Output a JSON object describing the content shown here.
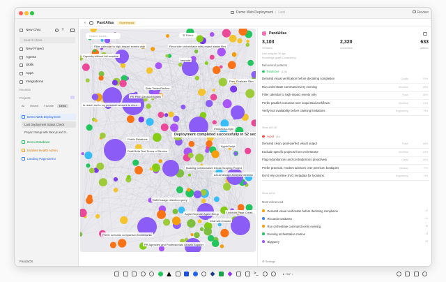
{
  "window": {
    "breadcrumb": [
      "Demo Web Deployment",
      "Last"
    ],
    "review": "Review",
    "lights": [
      "#ff5f57",
      "#febc2e",
      "#28c840"
    ]
  },
  "sidebar": {
    "new_chat": "New Chat",
    "search_placeholder": "Search chats...",
    "nav": [
      {
        "label": "New Project",
        "icon": "folder-plus-icon"
      },
      {
        "label": "Agents",
        "icon": "agent-icon"
      },
      {
        "label": "Skills",
        "icon": "skills-icon"
      },
      {
        "label": "Apps",
        "icon": "apps-icon"
      },
      {
        "label": "Integrations",
        "icon": "integrations-icon"
      }
    ],
    "recents_label": "Recents",
    "projects_label": "Projects",
    "filters": [
      "All",
      "Recent",
      "Favorite",
      "Demo"
    ],
    "projects": [
      {
        "label": "Demo Web Deployment",
        "color": "#3b82f6",
        "active": true
      },
      {
        "label": "Demo Database",
        "color": "#22c55e",
        "active": false
      },
      {
        "label": "Incident Health Admin",
        "color": "#f59e0b",
        "active": false
      },
      {
        "label": "Landing Page Demo",
        "color": "#3b82f6",
        "active": false
      }
    ],
    "subitems": [
      "Last Deployment Status Check",
      "Project Setup with Next.js and S..."
    ],
    "workspace": "PandaOS"
  },
  "tab": {
    "title": "PandAtlas",
    "badge": "Experimental"
  },
  "graph": {
    "search_placeholder": "Search nodes...",
    "filters_label": "Filters",
    "labels": [
      {
        "text": "Filter calendar to high-impact events only"
      },
      {
        "text": "Reconcile orchestrator with project status files"
      },
      {
        "text": "Capacity without full rewrites"
      },
      {
        "text": "keynote"
      },
      {
        "text": "Prev. Evaluate Slim..."
      },
      {
        "text": "Beta Tester Review"
      },
      {
        "text": "PR Pitch Decision Matrix"
      },
      {
        "text": "to reach out to my personal network to chec..."
      },
      {
        "text": "PandaOs-Legal"
      },
      {
        "text": "Deployment completed successfully in 52 seconds with",
        "big": true
      },
      {
        "text": "Public Relations"
      },
      {
        "text": "AppleScript"
      },
      {
        "text": "Draft Beta Test Terms of Service"
      },
      {
        "text": "Building Collaborative Decks Scoping Project"
      },
      {
        "text": "AI Landscape Analysis German"
      },
      {
        "text": "DMW usage retention query"
      },
      {
        "text": "LinkedIn Page Creati..."
      },
      {
        "text": "Apple Keynote Agent Setup"
      },
      {
        "text": "Chat with Claude"
      },
      {
        "text": "Prefer scenario comparison frameworks"
      },
      {
        "text": "PR Agencies and Professionals Growth Support"
      }
    ]
  },
  "panel": {
    "title": "PandAtlas",
    "stats": [
      {
        "value": "3,103",
        "label": "memories"
      },
      {
        "value": "2,320",
        "label": "connections"
      },
      {
        "value": "633",
        "label": "patterns"
      }
    ],
    "analyzed": "Last analyzed 3h ago",
    "analyzed_sub": "Knowledge graph Consistency",
    "behavioral_label": "Behavioral patterns",
    "reinforce": {
      "label": "Reinforce",
      "count": "(128)",
      "color": "#22c55e"
    },
    "reinforce_items": [
      {
        "text": "Demand visual verification before declaring completion",
        "meta": "Quality",
        "count": "92%"
      },
      {
        "text": "Run orchestrate command every evening",
        "meta": "Workflow",
        "count": "88%"
      },
      {
        "text": "Filter calendar to high-impact events only",
        "meta": "Focus",
        "count": "85%"
      },
      {
        "text": "Prefer parallel execution over sequential workflows",
        "meta": "Workflow",
        "count": "81%"
      },
      {
        "text": "Verify tool availability before claiming limitations",
        "meta": "Engineering",
        "count": "79%"
      }
    ],
    "show_all": "Show all 128",
    "avoid": {
      "label": "Avoid",
      "count": "(54)",
      "color": "#ef4444"
    },
    "avoid_items": [
      {
        "text": "Demand clean, pixel-perfect visual output",
        "meta": "Polish",
        "count": "88%"
      },
      {
        "text": "Exclude specific projects from orchestrator",
        "meta": "Workflow",
        "count": "84%"
      },
      {
        "text": "Flag redundancies and contradictions proactively",
        "meta": "Clarity",
        "count": "80%"
      },
      {
        "text": "Prefer practical, modern advisors over premium boutiques",
        "meta": "Advisory",
        "count": "77%"
      },
      {
        "text": "Don't rely on inline SVG metadata for locations",
        "meta": "Engineering",
        "count": "74%"
      }
    ],
    "show_all_avoid": "Show all 54",
    "most_label": "Most referenced",
    "most_items": [
      {
        "text": "Demand visual verification before declaring completion",
        "color": "#f59e0b",
        "count": "47"
      },
      {
        "text": "Riccardo Gasbarro",
        "color": "#3b82f6",
        "count": "41"
      },
      {
        "text": "Run orchestrate command every evening",
        "color": "#f59e0b",
        "count": "38"
      },
      {
        "text": "Evening orchestration routine",
        "color": "#22c55e",
        "count": "33"
      },
      {
        "text": "BigQuery",
        "color": "#a855f7",
        "count": "29"
      }
    ],
    "settings": "Settings"
  },
  "dock": {
    "status": "● +34°  ↓"
  }
}
